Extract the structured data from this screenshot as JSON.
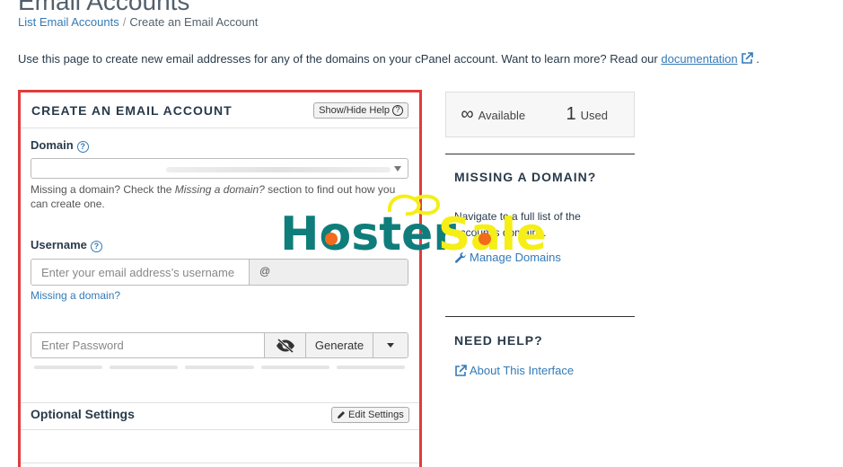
{
  "header": {
    "title": "Email Accounts",
    "breadcrumb": {
      "parent": "List Email Accounts",
      "separator": "/",
      "current": "Create an Email Account"
    },
    "intro": {
      "text": "Use this page to create new email addresses for any of the domains on your cPanel account. Want to learn more? Read our ",
      "link": "documentation",
      "suffix": "."
    }
  },
  "form": {
    "title": "CREATE AN EMAIL ACCOUNT",
    "help_toggle": "Show/Hide Help",
    "domain": {
      "label": "Domain",
      "hint_prefix": "Missing a domain? Check the ",
      "hint_em": "Missing a domain?",
      "hint_suffix": " section to find out how you can create one."
    },
    "username": {
      "label": "Username",
      "placeholder": "Enter your email address’s username",
      "at": "@",
      "missing_link": "Missing a domain?"
    },
    "password": {
      "placeholder": "Enter Password",
      "generate": "Generate"
    },
    "optional": {
      "title": "Optional Settings",
      "edit": "Edit Settings"
    }
  },
  "stats": {
    "available_value": "∞",
    "available_label": "Available",
    "used_value": "1",
    "used_label": "Used"
  },
  "sidebar": {
    "missing_title": "MISSING A DOMAIN?",
    "missing_text": "Navigate to a full list of the account’s domains.",
    "manage_link": "Manage Domains",
    "help_title": "NEED HELP?",
    "about_link": "About This Interface"
  },
  "watermark": {
    "word1": "Hoster",
    "word2": "Sale"
  },
  "colors": {
    "accent_link": "#337ab7",
    "card_border": "#e03c3c",
    "watermark_teal": "#0f7d7a",
    "watermark_yellow": "#f5ee17",
    "watermark_dot": "#f26a1b"
  }
}
